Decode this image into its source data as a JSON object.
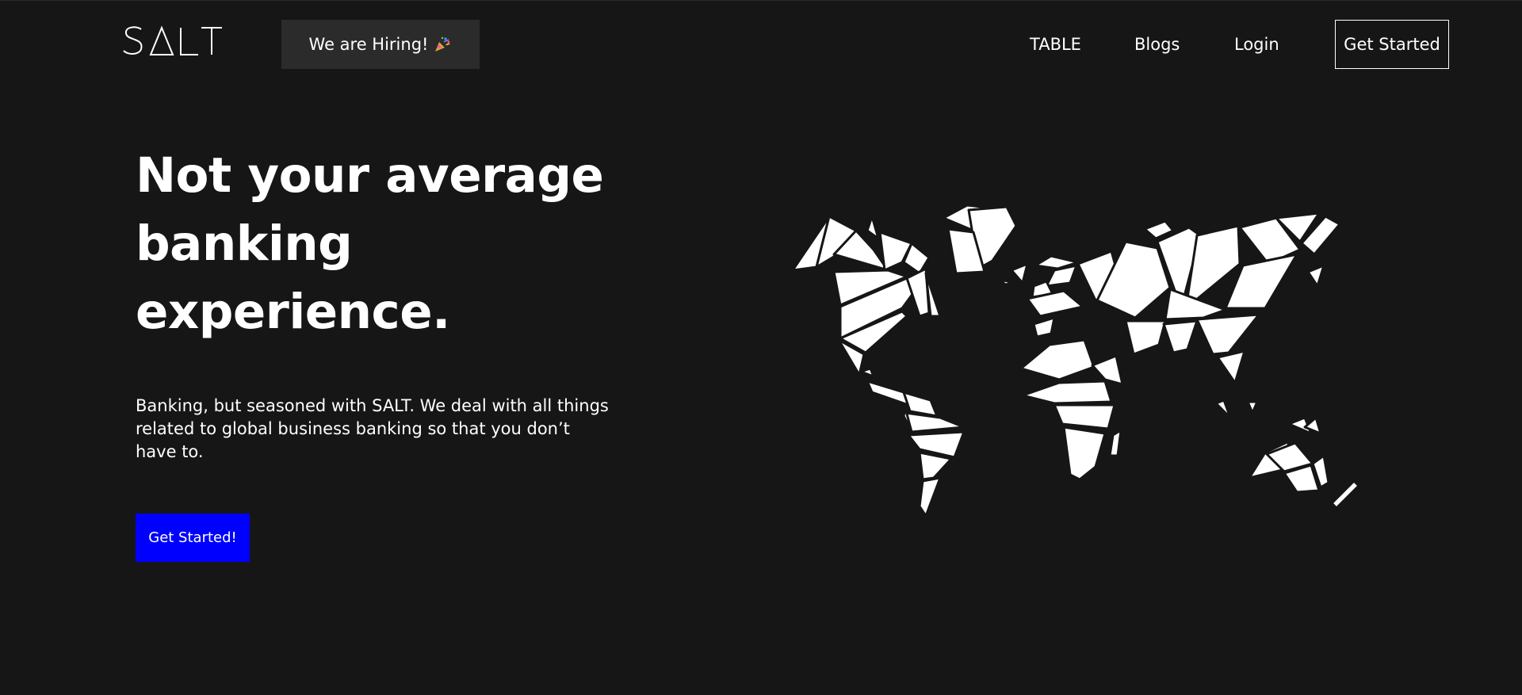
{
  "header": {
    "logo_text": "SALT",
    "hiring_label": "We are Hiring!",
    "hiring_icon": "party-popper-icon",
    "nav": {
      "table": "TABLE",
      "blogs": "Blogs",
      "login": "Login",
      "get_started": "Get Started"
    }
  },
  "hero": {
    "title": "Not your average banking experience.",
    "subtitle": "Banking, but seasoned with SALT. We deal with all things related to global business banking so that you don’t have to.",
    "cta_label": "Get Started!"
  },
  "colors": {
    "background": "#161616",
    "hiring_bg": "#2b2b2b",
    "accent_blue": "#0000ff",
    "text": "#ffffff"
  },
  "illustration": "world-map-geometric-icon"
}
